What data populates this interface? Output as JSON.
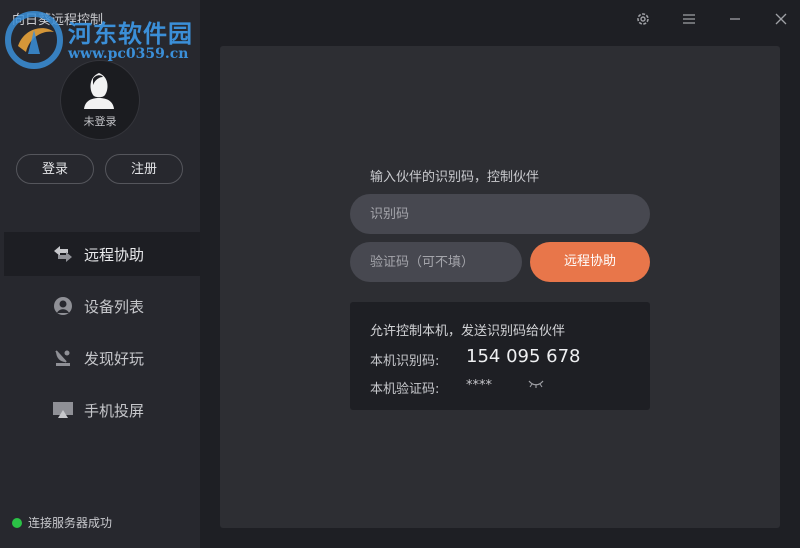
{
  "app": {
    "title": "向日葵远程控制"
  },
  "watermark": {
    "name": "河东软件园",
    "url": "www.pc0359.cn"
  },
  "user": {
    "status": "未登录"
  },
  "auth": {
    "login_label": "登录",
    "register_label": "注册"
  },
  "nav": {
    "items": [
      {
        "label": "远程协助",
        "icon": "remote-assist-icon",
        "active": true
      },
      {
        "label": "设备列表",
        "icon": "device-list-icon",
        "active": false
      },
      {
        "label": "发现好玩",
        "icon": "discover-icon",
        "active": false
      },
      {
        "label": "手机投屏",
        "icon": "screen-cast-icon",
        "active": false
      }
    ]
  },
  "status": {
    "text": "连接服务器成功",
    "color": "#2bc246"
  },
  "window_controls": [
    "gear-icon",
    "menu-icon",
    "minimize-icon",
    "close-icon"
  ],
  "remote": {
    "prompt": "输入伙伴的识别码，控制伙伴",
    "id_placeholder": "识别码",
    "code_placeholder": "验证码（可不填）",
    "assist_button": "远程协助"
  },
  "local": {
    "description": "允许控制本机，发送识别码给伙伴",
    "id_label": "本机识别码:",
    "id_value": "154 095 678",
    "code_label": "本机验证码:",
    "code_value": "****"
  },
  "colors": {
    "accent": "#e8764a",
    "background": "#1e1f24",
    "panel": "#2d2e33"
  }
}
